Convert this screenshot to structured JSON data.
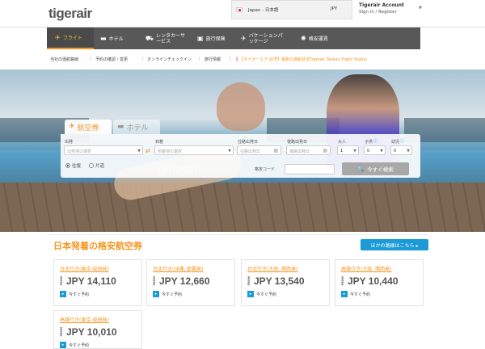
{
  "header": {
    "logo_text": "tigerair",
    "locale": "Japan - 日本語",
    "currency": "JPY",
    "account_title": "Tigerair Account",
    "account_links": "Sign in / Register"
  },
  "nav": {
    "items": [
      {
        "label": "フライト",
        "icon": "airplane-icon"
      },
      {
        "label": "ホテル",
        "icon": "bed-icon"
      },
      {
        "label": "レンタカーサービス",
        "icon": "car-icon"
      },
      {
        "label": "旅行保険",
        "icon": "insurance-icon"
      },
      {
        "label": "バケーションパッケージ",
        "icon": "package-icon"
      },
      {
        "label": "格安運賃",
        "icon": "gear-icon"
      }
    ]
  },
  "subnav": {
    "links": [
      "当社の運航路線",
      "予約の確認・変更",
      "オンラインチェックイン",
      "旅行情報"
    ],
    "alert": "【タイガーエア-台湾】最新の運航状況Tigerair Taiwan Flight Status"
  },
  "search": {
    "tab_flight": "航空券",
    "tab_hotel": "ホテル",
    "depart_label": "出発",
    "depart_placeholder": "出発地の選択",
    "arrive_label": "到着",
    "arrive_placeholder": "到着地の選択",
    "outbound_label": "往路出発日",
    "outbound_placeholder": "往路出発日",
    "return_label": "復路出発日",
    "return_placeholder": "復路出発日",
    "adult_label": "大人",
    "adult_value": "1",
    "child_label": "子供",
    "child_value": "0",
    "infant_label": "幼児",
    "infant_value": "0",
    "roundtrip_label": "往復",
    "oneway_label": "片道",
    "promo_label": "格安コード",
    "search_button": "今すぐ検索"
  },
  "watermark": "@haozh",
  "deals": {
    "title": "日本発着の格安航空券",
    "more_button": "ほかの路線はこちら ▸",
    "from_label": "FROM",
    "book_label": "今すぐ予約",
    "cards": [
      {
        "route": "台北行き(東京-成田発)",
        "price": "JPY 14,110"
      },
      {
        "route": "台北行き(沖縄, 那覇発)",
        "price": "JPY 12,660"
      },
      {
        "route": "台北行き(大阪, 関西発)",
        "price": "JPY 13,540"
      },
      {
        "route": "高雄行き(大阪, 関西発)",
        "price": "JPY 10,440"
      },
      {
        "route": "高雄行き(東京-成田発)",
        "price": "JPY 10,010"
      }
    ]
  }
}
